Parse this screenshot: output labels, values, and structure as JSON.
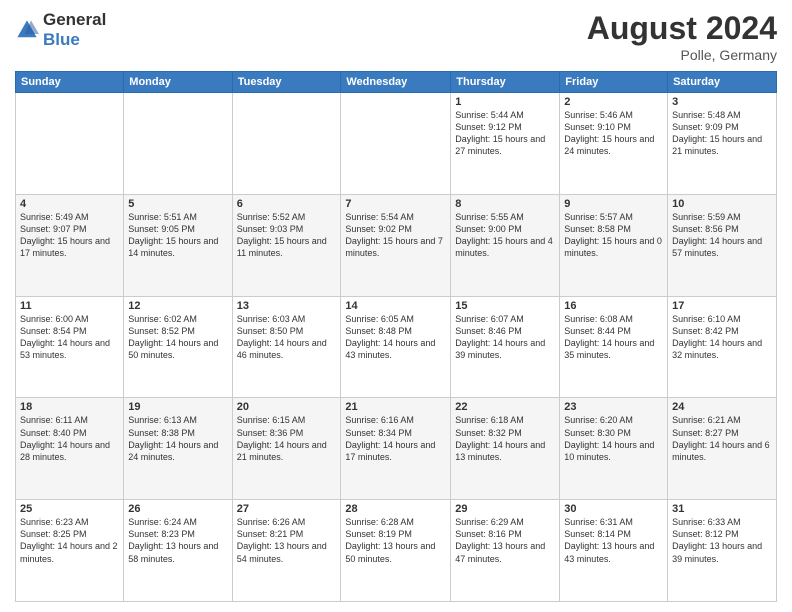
{
  "header": {
    "logo_general": "General",
    "logo_blue": "Blue",
    "month_year": "August 2024",
    "location": "Polle, Germany"
  },
  "weekdays": [
    "Sunday",
    "Monday",
    "Tuesday",
    "Wednesday",
    "Thursday",
    "Friday",
    "Saturday"
  ],
  "weeks": [
    [
      {
        "day": "",
        "info": ""
      },
      {
        "day": "",
        "info": ""
      },
      {
        "day": "",
        "info": ""
      },
      {
        "day": "",
        "info": ""
      },
      {
        "day": "1",
        "info": "Sunrise: 5:44 AM\nSunset: 9:12 PM\nDaylight: 15 hours and 27 minutes."
      },
      {
        "day": "2",
        "info": "Sunrise: 5:46 AM\nSunset: 9:10 PM\nDaylight: 15 hours and 24 minutes."
      },
      {
        "day": "3",
        "info": "Sunrise: 5:48 AM\nSunset: 9:09 PM\nDaylight: 15 hours and 21 minutes."
      }
    ],
    [
      {
        "day": "4",
        "info": "Sunrise: 5:49 AM\nSunset: 9:07 PM\nDaylight: 15 hours and 17 minutes."
      },
      {
        "day": "5",
        "info": "Sunrise: 5:51 AM\nSunset: 9:05 PM\nDaylight: 15 hours and 14 minutes."
      },
      {
        "day": "6",
        "info": "Sunrise: 5:52 AM\nSunset: 9:03 PM\nDaylight: 15 hours and 11 minutes."
      },
      {
        "day": "7",
        "info": "Sunrise: 5:54 AM\nSunset: 9:02 PM\nDaylight: 15 hours and 7 minutes."
      },
      {
        "day": "8",
        "info": "Sunrise: 5:55 AM\nSunset: 9:00 PM\nDaylight: 15 hours and 4 minutes."
      },
      {
        "day": "9",
        "info": "Sunrise: 5:57 AM\nSunset: 8:58 PM\nDaylight: 15 hours and 0 minutes."
      },
      {
        "day": "10",
        "info": "Sunrise: 5:59 AM\nSunset: 8:56 PM\nDaylight: 14 hours and 57 minutes."
      }
    ],
    [
      {
        "day": "11",
        "info": "Sunrise: 6:00 AM\nSunset: 8:54 PM\nDaylight: 14 hours and 53 minutes."
      },
      {
        "day": "12",
        "info": "Sunrise: 6:02 AM\nSunset: 8:52 PM\nDaylight: 14 hours and 50 minutes."
      },
      {
        "day": "13",
        "info": "Sunrise: 6:03 AM\nSunset: 8:50 PM\nDaylight: 14 hours and 46 minutes."
      },
      {
        "day": "14",
        "info": "Sunrise: 6:05 AM\nSunset: 8:48 PM\nDaylight: 14 hours and 43 minutes."
      },
      {
        "day": "15",
        "info": "Sunrise: 6:07 AM\nSunset: 8:46 PM\nDaylight: 14 hours and 39 minutes."
      },
      {
        "day": "16",
        "info": "Sunrise: 6:08 AM\nSunset: 8:44 PM\nDaylight: 14 hours and 35 minutes."
      },
      {
        "day": "17",
        "info": "Sunrise: 6:10 AM\nSunset: 8:42 PM\nDaylight: 14 hours and 32 minutes."
      }
    ],
    [
      {
        "day": "18",
        "info": "Sunrise: 6:11 AM\nSunset: 8:40 PM\nDaylight: 14 hours and 28 minutes."
      },
      {
        "day": "19",
        "info": "Sunrise: 6:13 AM\nSunset: 8:38 PM\nDaylight: 14 hours and 24 minutes."
      },
      {
        "day": "20",
        "info": "Sunrise: 6:15 AM\nSunset: 8:36 PM\nDaylight: 14 hours and 21 minutes."
      },
      {
        "day": "21",
        "info": "Sunrise: 6:16 AM\nSunset: 8:34 PM\nDaylight: 14 hours and 17 minutes."
      },
      {
        "day": "22",
        "info": "Sunrise: 6:18 AM\nSunset: 8:32 PM\nDaylight: 14 hours and 13 minutes."
      },
      {
        "day": "23",
        "info": "Sunrise: 6:20 AM\nSunset: 8:30 PM\nDaylight: 14 hours and 10 minutes."
      },
      {
        "day": "24",
        "info": "Sunrise: 6:21 AM\nSunset: 8:27 PM\nDaylight: 14 hours and 6 minutes."
      }
    ],
    [
      {
        "day": "25",
        "info": "Sunrise: 6:23 AM\nSunset: 8:25 PM\nDaylight: 14 hours and 2 minutes."
      },
      {
        "day": "26",
        "info": "Sunrise: 6:24 AM\nSunset: 8:23 PM\nDaylight: 13 hours and 58 minutes."
      },
      {
        "day": "27",
        "info": "Sunrise: 6:26 AM\nSunset: 8:21 PM\nDaylight: 13 hours and 54 minutes."
      },
      {
        "day": "28",
        "info": "Sunrise: 6:28 AM\nSunset: 8:19 PM\nDaylight: 13 hours and 50 minutes."
      },
      {
        "day": "29",
        "info": "Sunrise: 6:29 AM\nSunset: 8:16 PM\nDaylight: 13 hours and 47 minutes."
      },
      {
        "day": "30",
        "info": "Sunrise: 6:31 AM\nSunset: 8:14 PM\nDaylight: 13 hours and 43 minutes."
      },
      {
        "day": "31",
        "info": "Sunrise: 6:33 AM\nSunset: 8:12 PM\nDaylight: 13 hours and 39 minutes."
      }
    ]
  ]
}
